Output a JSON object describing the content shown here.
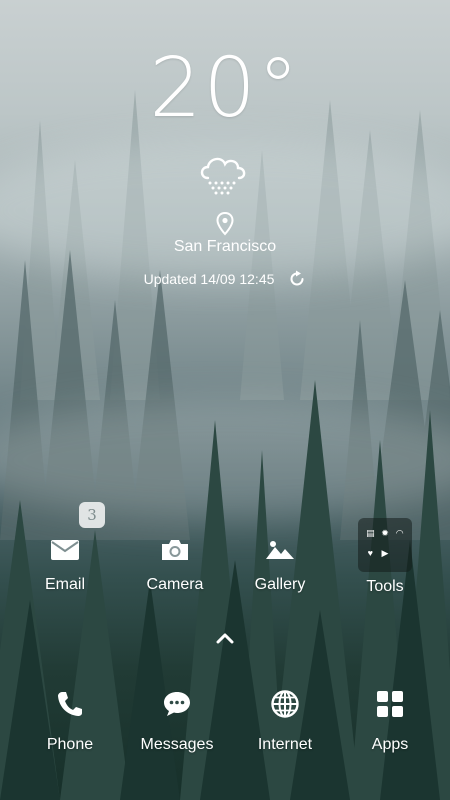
{
  "weather": {
    "temperature": "20°",
    "city": "San Francisco",
    "updated": "Updated 14/09 12:45",
    "icon": "snow-cloud-icon"
  },
  "home": {
    "apps": [
      {
        "label": "Email",
        "icon": "mail-icon",
        "badge": "3"
      },
      {
        "label": "Camera",
        "icon": "camera-icon"
      },
      {
        "label": "Gallery",
        "icon": "image-icon"
      },
      {
        "label": "Tools",
        "icon": "folder-icon"
      }
    ],
    "tools_folder_items": [
      "notes-icon",
      "gear-icon",
      "gauge-icon",
      "heart-icon",
      "play-icon"
    ]
  },
  "dock": {
    "apps": [
      {
        "label": "Phone",
        "icon": "phone-icon"
      },
      {
        "label": "Messages",
        "icon": "chat-bubble-icon"
      },
      {
        "label": "Internet",
        "icon": "globe-icon"
      },
      {
        "label": "Apps",
        "icon": "apps-grid-icon"
      }
    ]
  },
  "colors": {
    "text": "#ffffff",
    "sky": "#c9d0d1",
    "forest": "#17302a"
  }
}
